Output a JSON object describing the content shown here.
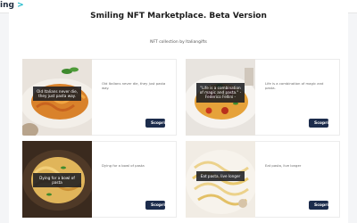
{
  "app": {
    "logo_text": "ing",
    "logo_arrow": ">"
  },
  "header": {
    "title": "Smiling NFT Marketplace. Beta Version",
    "subtitle": "NFT collection by Italiangifts"
  },
  "cards": [
    {
      "image_caption": "Old Italians never die, they just pasta way.",
      "image_author": "",
      "description": "Old Italians never die, they just pasta way.",
      "button_label": "Scopri"
    },
    {
      "image_caption": "\"Life is a combination of magic and pasta.\"",
      "image_author": "- Federico Fellini -",
      "description": "Life is a combination of magic and pasta.",
      "button_label": "Scopri"
    },
    {
      "image_caption": "Dying for a bowl of pasta",
      "image_author": "",
      "description": "Dying for a bowl of pasta",
      "button_label": "Scopri"
    },
    {
      "image_caption": "Eat pasta, live longer",
      "image_author": "",
      "description": "Eat pasta, live longer",
      "button_label": "Scopri"
    }
  ],
  "colors": {
    "button_bg": "#1c2c4c",
    "accent": "#19b7c8",
    "panel_bg": "#ffffff",
    "page_bg": "#f4f5f7"
  }
}
